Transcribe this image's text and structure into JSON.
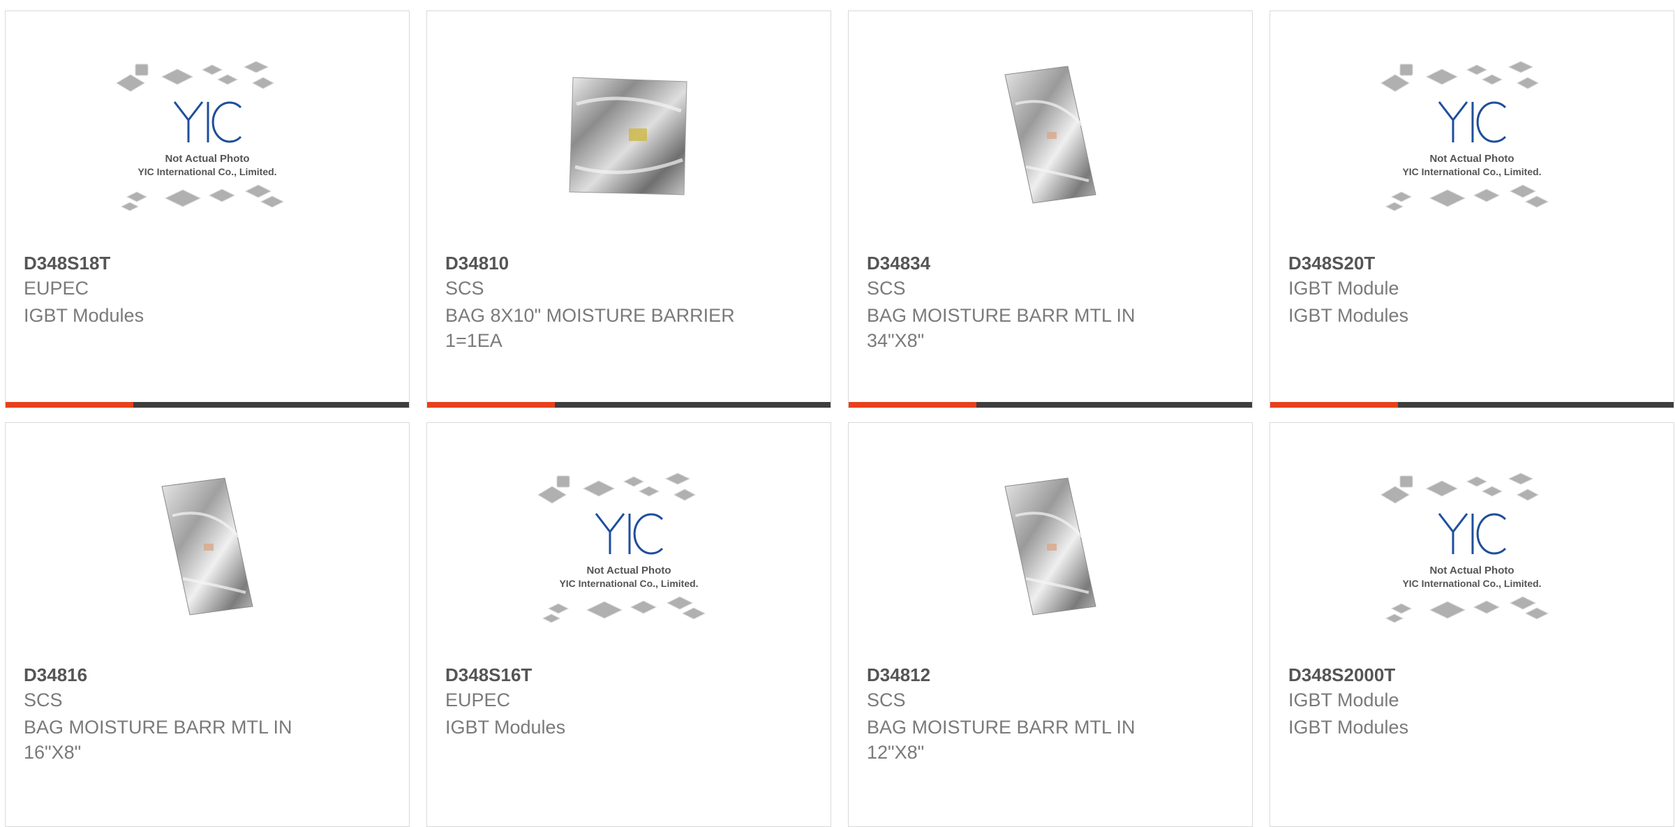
{
  "products": [
    {
      "part": "D348S18T",
      "manufacturer": "EUPEC",
      "description": "IGBT Modules",
      "image": "placeholder"
    },
    {
      "part": "D34810",
      "manufacturer": "SCS",
      "description": "BAG 8X10\" MOISTURE BARRIER 1=1EA",
      "image": "bag"
    },
    {
      "part": "D34834",
      "manufacturer": "SCS",
      "description": "BAG MOISTURE BARR MTL IN 34\"X8\"",
      "image": "bag"
    },
    {
      "part": "D348S20T",
      "manufacturer": "IGBT Module",
      "description": "IGBT Modules",
      "image": "placeholder"
    },
    {
      "part": "D34816",
      "manufacturer": "SCS",
      "description": "BAG MOISTURE BARR MTL IN 16\"X8\"",
      "image": "bag"
    },
    {
      "part": "D348S16T",
      "manufacturer": "EUPEC",
      "description": "IGBT Modules",
      "image": "placeholder"
    },
    {
      "part": "D34812",
      "manufacturer": "SCS",
      "description": "BAG MOISTURE BARR MTL IN 12\"X8\"",
      "image": "bag"
    },
    {
      "part": "D348S2000T",
      "manufacturer": "IGBT Module",
      "description": "IGBT Modules",
      "image": "placeholder"
    }
  ],
  "placeholder": {
    "logo": "YIC",
    "line1": "Not Actual Photo",
    "line2": "YIC International Co., Limited."
  },
  "colors": {
    "accent": "#e8401c",
    "bar": "#3e3e3e",
    "logo": "#1f4e9c"
  }
}
